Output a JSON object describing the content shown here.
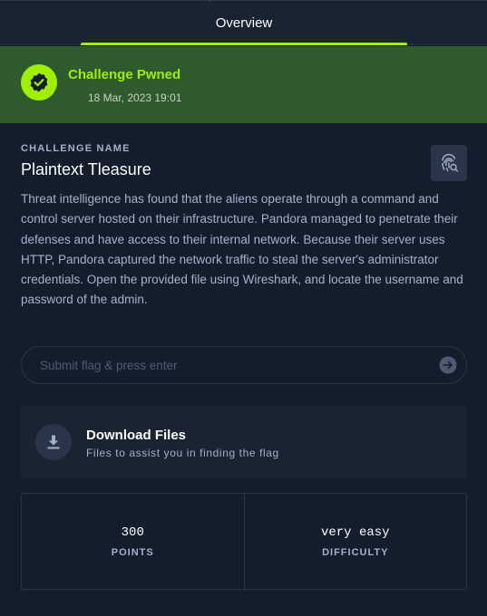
{
  "tabs": {
    "overview_label": "Overview"
  },
  "status": {
    "title": "Challenge Pwned",
    "timestamp": "18 Mar, 2023 19:01",
    "accent_color": "#9fef00",
    "icon": "verified-check-icon"
  },
  "challenge": {
    "section_label": "CHALLENGE NAME",
    "name": "Plaintext Tleasure",
    "description": "Threat intelligence has found that the aliens operate through a command and control server hosted on their infrastructure. Pandora managed to penetrate their defenses and have access to their internal network. Because their server uses HTTP, Pandora captured the network traffic to steal the server's administrator credentials. Open the provided file using Wireshark, and locate the username and password of the admin.",
    "writeup_icon": "fingerprint-search-icon"
  },
  "flag_input": {
    "placeholder": "Submit flag & press enter",
    "value": "",
    "submit_icon": "arrow-right-circle-icon"
  },
  "download": {
    "title": "Download Files",
    "subtitle": "Files to assist you in finding the flag",
    "icon": "download-icon"
  },
  "stats": {
    "points_value": "300",
    "points_label": "POINTS",
    "difficulty_value": "very easy",
    "difficulty_label": "DIFFICULTY"
  }
}
